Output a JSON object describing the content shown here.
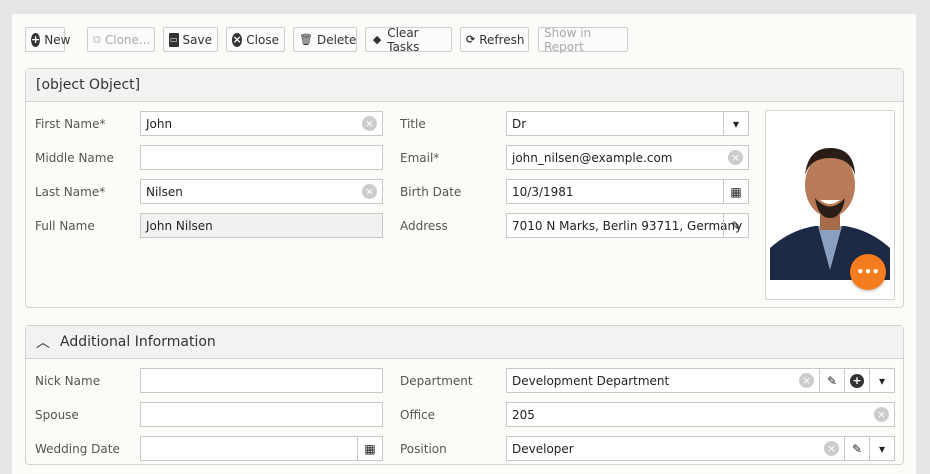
{
  "toolbar": {
    "new": "New",
    "clone": "Clone...",
    "save": "Save",
    "close": "Close",
    "delete": "Delete",
    "clear_tasks": "Clear Tasks",
    "refresh": "Refresh",
    "show_in_report": "Show in Report"
  },
  "details": {
    "title": {
      "label": "Title",
      "value": "Dr"
    },
    "first_name": {
      "label": "First Name*",
      "value": "John"
    },
    "middle_name": {
      "label": "Middle Name",
      "value": ""
    },
    "last_name": {
      "label": "Last Name*",
      "value": "Nilsen"
    },
    "full_name": {
      "label": "Full Name",
      "value": "John Nilsen"
    },
    "email": {
      "label": "Email*",
      "value": "john_nilsen@example.com"
    },
    "birth_date": {
      "label": "Birth Date",
      "value": "10/3/1981"
    },
    "address": {
      "label": "Address",
      "value": "7010 N Marks, Berlin 93711, Germany"
    }
  },
  "additional": {
    "title": "Additional Information",
    "nick_name": {
      "label": "Nick Name",
      "value": ""
    },
    "spouse": {
      "label": "Spouse",
      "value": ""
    },
    "wedding_date": {
      "label": "Wedding Date",
      "value": ""
    },
    "department": {
      "label": "Department",
      "value": "Development Department"
    },
    "office": {
      "label": "Office",
      "value": "205"
    },
    "position": {
      "label": "Position",
      "value": "Developer"
    }
  },
  "colors": {
    "accent": "#f57c1f"
  }
}
